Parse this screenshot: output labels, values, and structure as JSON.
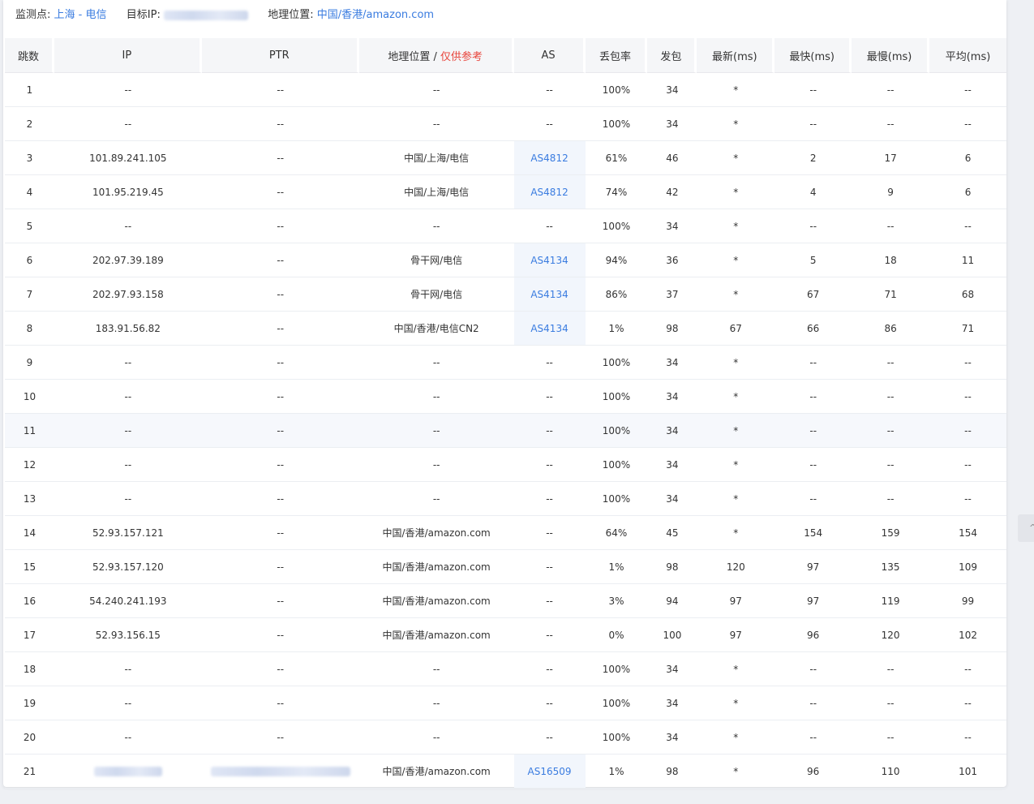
{
  "info": {
    "monitor_label": "监测点:",
    "monitor_value": "上海 - 电信",
    "target_label": "目标IP:",
    "geo_label": "地理位置:",
    "geo_value": "中国/香港/amazon.com"
  },
  "headers": {
    "hop": "跳数",
    "ip": "IP",
    "ptr": "PTR",
    "geo": "地理位置 / ",
    "geo_ref": "仅供参考",
    "as": "AS",
    "loss": "丢包率",
    "sent": "发包",
    "last": "最新(ms)",
    "best": "最快(ms)",
    "worst": "最慢(ms)",
    "avg": "平均(ms)"
  },
  "rows": [
    {
      "hop": "1",
      "ip": "--",
      "ptr": "--",
      "geo": "--",
      "as": "--",
      "loss": "100%",
      "sent": "34",
      "last": "*",
      "best": "--",
      "worst": "--",
      "avg": "--"
    },
    {
      "hop": "2",
      "ip": "--",
      "ptr": "--",
      "geo": "--",
      "as": "--",
      "loss": "100%",
      "sent": "34",
      "last": "*",
      "best": "--",
      "worst": "--",
      "avg": "--"
    },
    {
      "hop": "3",
      "ip": "101.89.241.105",
      "ptr": "--",
      "geo": "中国/上海/电信",
      "as": "AS4812",
      "loss": "61%",
      "sent": "46",
      "last": "*",
      "best": "2",
      "worst": "17",
      "avg": "6"
    },
    {
      "hop": "4",
      "ip": "101.95.219.45",
      "ptr": "--",
      "geo": "中国/上海/电信",
      "as": "AS4812",
      "loss": "74%",
      "sent": "42",
      "last": "*",
      "best": "4",
      "worst": "9",
      "avg": "6"
    },
    {
      "hop": "5",
      "ip": "--",
      "ptr": "--",
      "geo": "--",
      "as": "--",
      "loss": "100%",
      "sent": "34",
      "last": "*",
      "best": "--",
      "worst": "--",
      "avg": "--"
    },
    {
      "hop": "6",
      "ip": "202.97.39.189",
      "ptr": "--",
      "geo": "骨干网/电信",
      "as": "AS4134",
      "loss": "94%",
      "sent": "36",
      "last": "*",
      "best": "5",
      "worst": "18",
      "avg": "11"
    },
    {
      "hop": "7",
      "ip": "202.97.93.158",
      "ptr": "--",
      "geo": "骨干网/电信",
      "as": "AS4134",
      "loss": "86%",
      "sent": "37",
      "last": "*",
      "best": "67",
      "worst": "71",
      "avg": "68"
    },
    {
      "hop": "8",
      "ip": "183.91.56.82",
      "ptr": "--",
      "geo": "中国/香港/电信CN2",
      "as": "AS4134",
      "loss": "1%",
      "sent": "98",
      "last": "67",
      "best": "66",
      "worst": "86",
      "avg": "71"
    },
    {
      "hop": "9",
      "ip": "--",
      "ptr": "--",
      "geo": "--",
      "as": "--",
      "loss": "100%",
      "sent": "34",
      "last": "*",
      "best": "--",
      "worst": "--",
      "avg": "--"
    },
    {
      "hop": "10",
      "ip": "--",
      "ptr": "--",
      "geo": "--",
      "as": "--",
      "loss": "100%",
      "sent": "34",
      "last": "*",
      "best": "--",
      "worst": "--",
      "avg": "--"
    },
    {
      "hop": "11",
      "ip": "--",
      "ptr": "--",
      "geo": "--",
      "as": "--",
      "loss": "100%",
      "sent": "34",
      "last": "*",
      "best": "--",
      "worst": "--",
      "avg": "--"
    },
    {
      "hop": "12",
      "ip": "--",
      "ptr": "--",
      "geo": "--",
      "as": "--",
      "loss": "100%",
      "sent": "34",
      "last": "*",
      "best": "--",
      "worst": "--",
      "avg": "--"
    },
    {
      "hop": "13",
      "ip": "--",
      "ptr": "--",
      "geo": "--",
      "as": "--",
      "loss": "100%",
      "sent": "34",
      "last": "*",
      "best": "--",
      "worst": "--",
      "avg": "--"
    },
    {
      "hop": "14",
      "ip": "52.93.157.121",
      "ptr": "--",
      "geo": "中国/香港/amazon.com",
      "as": "--",
      "loss": "64%",
      "sent": "45",
      "last": "*",
      "best": "154",
      "worst": "159",
      "avg": "154"
    },
    {
      "hop": "15",
      "ip": "52.93.157.120",
      "ptr": "--",
      "geo": "中国/香港/amazon.com",
      "as": "--",
      "loss": "1%",
      "sent": "98",
      "last": "120",
      "best": "97",
      "worst": "135",
      "avg": "109"
    },
    {
      "hop": "16",
      "ip": "54.240.241.193",
      "ptr": "--",
      "geo": "中国/香港/amazon.com",
      "as": "--",
      "loss": "3%",
      "sent": "94",
      "last": "97",
      "best": "97",
      "worst": "119",
      "avg": "99"
    },
    {
      "hop": "17",
      "ip": "52.93.156.15",
      "ptr": "--",
      "geo": "中国/香港/amazon.com",
      "as": "--",
      "loss": "0%",
      "sent": "100",
      "last": "97",
      "best": "96",
      "worst": "120",
      "avg": "102"
    },
    {
      "hop": "18",
      "ip": "--",
      "ptr": "--",
      "geo": "--",
      "as": "--",
      "loss": "100%",
      "sent": "34",
      "last": "*",
      "best": "--",
      "worst": "--",
      "avg": "--"
    },
    {
      "hop": "19",
      "ip": "--",
      "ptr": "--",
      "geo": "--",
      "as": "--",
      "loss": "100%",
      "sent": "34",
      "last": "*",
      "best": "--",
      "worst": "--",
      "avg": "--"
    },
    {
      "hop": "20",
      "ip": "--",
      "ptr": "--",
      "geo": "--",
      "as": "--",
      "loss": "100%",
      "sent": "34",
      "last": "*",
      "best": "--",
      "worst": "--",
      "avg": "--"
    },
    {
      "hop": "21",
      "ip": "",
      "ptr": "",
      "geo": "中国/香港/amazon.com",
      "as": "AS16509",
      "loss": "1%",
      "sent": "98",
      "last": "*",
      "best": "96",
      "worst": "110",
      "avg": "101"
    }
  ],
  "colors": {
    "link": "#3a7ce0",
    "reference_warning": "#e8453c",
    "header_bg": "#f5f6f8"
  }
}
